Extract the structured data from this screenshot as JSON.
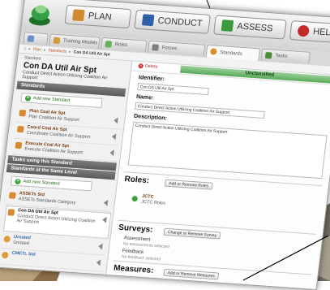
{
  "topnav": {
    "plan": "PLAN",
    "conduct": "CONDUCT",
    "assess": "ASSESS",
    "help": "HELP"
  },
  "tabs": [
    "Home",
    "Training Models",
    "Roles",
    "Forces",
    "Standards",
    "Tasks"
  ],
  "breadcrumbs": [
    "Plan",
    "Standards",
    "Con DA Util Air Spt"
  ],
  "left": {
    "subtitle": "Standard",
    "title": "Con DA Util Air Spt",
    "description": "Conduct Direct Action Utilizing Coalition Air Support",
    "standards_header": "Standards",
    "add_standard": "Add new Standard",
    "standards": [
      {
        "title": "Plan Coal Air Spt",
        "sub": "Plan Coalition Air Support"
      },
      {
        "title": "Coord Coal Air Spt",
        "sub": "Coordinate Coalition Air Support"
      },
      {
        "title": "Execute Coal Air Spt",
        "sub": "Execute Coalition Air Support"
      }
    ],
    "tasks_header": "Tasks using this Standard",
    "same_level_header": "Standards at the Same Level",
    "add_standard2": "Add new Standard",
    "same_level": [
      {
        "title": "ASSETs Std",
        "sub": "ASSETs Standards Category"
      },
      {
        "title": "Con DA Util Air Spt",
        "sub": "Conduct Direct Action Utilizing Coalition Air Support"
      },
      {
        "title": "Unrated",
        "sub": "Unrated"
      },
      {
        "title": "CMETL Std",
        "sub": ""
      }
    ]
  },
  "right": {
    "delete": "Delete",
    "classification": "Unclassified",
    "identifier_label": "Identifier:",
    "identifier_value": "Con DA Util Air Spt",
    "name_label": "Name:",
    "name_value": "Conduct Direct Action Utilizing Coalition Air Support",
    "description_label": "Description:",
    "description_value": "Conduct Direct Action Utilizing Coalition Air Support",
    "roles_header": "Roles:",
    "roles_button": "Add or Remove Roles",
    "role_title": "JCTC",
    "role_sub": "JCTC Roles",
    "surveys_header": "Surveys:",
    "surveys_button": "Change or Remove Survey",
    "assessment_label": "Assessment",
    "assessment_value": "No assessments selected",
    "feedback_label": "Feedback",
    "feedback_value": "No feedback selected",
    "measures_header": "Measures:",
    "measures_button": "Add or Remove Measures"
  }
}
